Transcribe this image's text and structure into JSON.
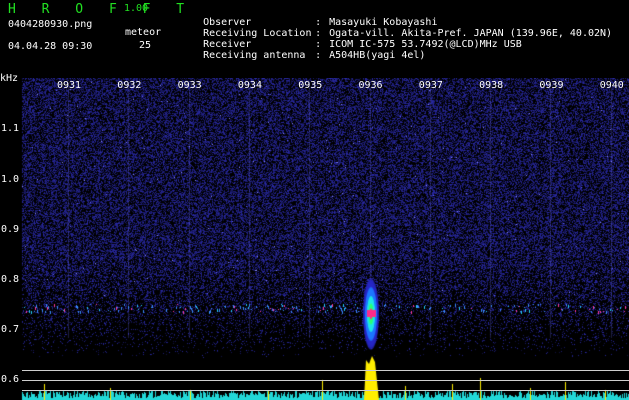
{
  "app": {
    "title": "H R O F F T",
    "version": "1.00"
  },
  "file": {
    "name": "0404280930.png",
    "datetime": "04.04.28 09:30"
  },
  "meteor": {
    "label": "meteor",
    "count": "25"
  },
  "meta": [
    {
      "label": "Observer",
      "value": "Masayuki Kobayashi"
    },
    {
      "label": "Receiving Location",
      "value": "Ogata-vill. Akita-Pref. JAPAN (139.96E, 40.02N)"
    },
    {
      "label": "Receiver",
      "value": "ICOM IC-575 53.7492(@LCD)MHz USB"
    },
    {
      "label": "Receiving antenna",
      "value": "A504HB(yagi 4el)"
    }
  ],
  "colors": {
    "title": "#22e022",
    "background": "#000000",
    "noise": "#1a1a9a",
    "signal": "#ff2a8a",
    "footer": "#ffee00"
  },
  "chart_data": {
    "type": "heatmap",
    "ylabel": "kHz",
    "y_ticks": [
      "1.1",
      "1.0",
      "0.9",
      "0.8",
      "0.7",
      "0.6"
    ],
    "x_ticks": [
      "0931",
      "0932",
      "0933",
      "0934",
      "0935",
      "0936",
      "0937",
      "0938",
      "0939",
      "0940"
    ],
    "signal_band_khz": 0.74,
    "meteor_echo": {
      "time": "0936",
      "freq_khz": 0.73
    }
  }
}
